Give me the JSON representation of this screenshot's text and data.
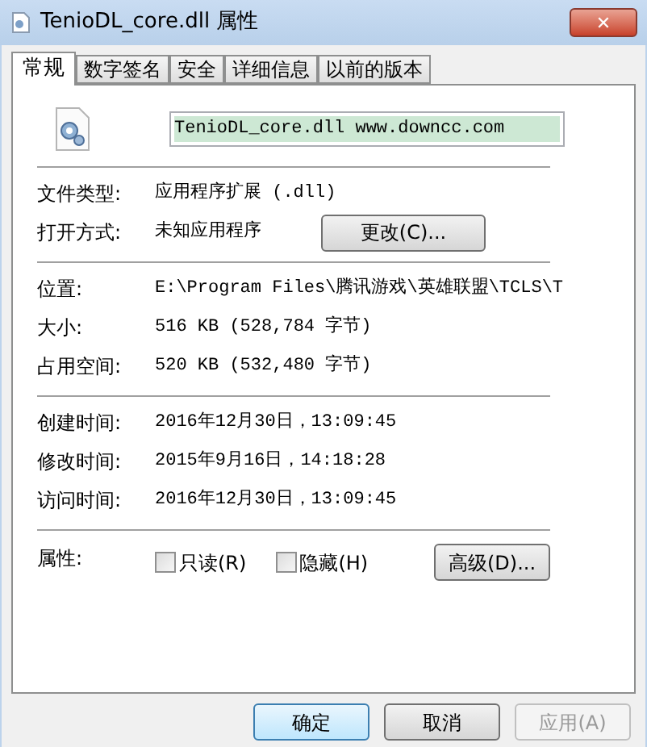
{
  "window": {
    "title": "TenioDL_core.dll 属性",
    "close": "✕"
  },
  "tabs": [
    {
      "label": "常规",
      "selected": true
    },
    {
      "label": "数字签名",
      "selected": false
    },
    {
      "label": "安全",
      "selected": false
    },
    {
      "label": "详细信息",
      "selected": false
    },
    {
      "label": "以前的版本",
      "selected": false
    }
  ],
  "name_field": {
    "value": "TenioDL_core.dll www.downcc.com"
  },
  "sections": [
    [
      {
        "label": "文件类型:",
        "value": "应用程序扩展 (.dll)"
      },
      {
        "label": "打开方式:",
        "value": "未知应用程序",
        "button": "更改(C)..."
      }
    ],
    [
      {
        "label": "位置:",
        "value": "E:\\Program Files\\腾讯游戏\\英雄联盟\\TCLS\\T"
      },
      {
        "label": "大小:",
        "value": "516 KB (528,784 字节)"
      },
      {
        "label": "占用空间:",
        "value": "520 KB (532,480 字节)"
      }
    ],
    [
      {
        "label": "创建时间:",
        "value": "2016年12月30日，13:09:45"
      },
      {
        "label": "修改时间:",
        "value": "2015年9月16日，14:18:28"
      },
      {
        "label": "访问时间:",
        "value": "2016年12月30日，13:09:45"
      }
    ]
  ],
  "attributes": {
    "label": "属性:",
    "checkboxes": [
      {
        "label": "只读(R)",
        "checked": false
      },
      {
        "label": "隐藏(H)",
        "checked": false
      }
    ],
    "button": "高级(D)..."
  },
  "buttons": [
    {
      "label": "确定",
      "default": true,
      "disabled": false
    },
    {
      "label": "取消",
      "default": false,
      "disabled": false
    },
    {
      "label": "应用(A)",
      "default": false,
      "disabled": true
    }
  ]
}
